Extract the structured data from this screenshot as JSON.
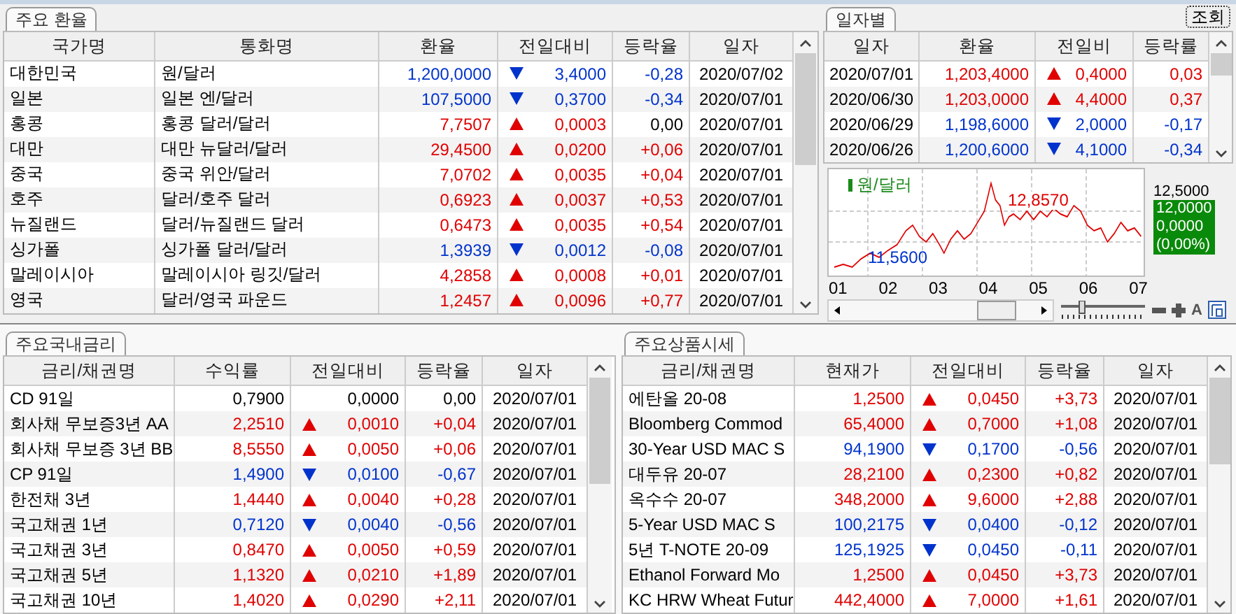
{
  "fx_panel": {
    "tab": "주요 환율",
    "columns": [
      "국가명",
      "통화명",
      "환율",
      "전일대비",
      "등락율",
      "일자"
    ],
    "rows": [
      {
        "cells": [
          "대한민국",
          "원/달러",
          "1,200,0000",
          "3,4000",
          "-0,28",
          "2020/07/02"
        ],
        "kind": "down",
        "color": "#0033cc"
      },
      {
        "cells": [
          "일본",
          "일본 엔/달러",
          "107,5000",
          "0,3700",
          "-0,34",
          "2020/07/01"
        ],
        "kind": "down",
        "color": "#0033cc"
      },
      {
        "cells": [
          "홍콩",
          "홍콩 달러/달러",
          "7,7507",
          "0,0003",
          "0,00",
          "2020/07/01"
        ],
        "kind": "up",
        "color": "#000000"
      },
      {
        "cells": [
          "대만",
          "대만 뉴달러/달러",
          "29,4500",
          "0,0200",
          "+0,06",
          "2020/07/01"
        ],
        "kind": "up",
        "color": "#e00000"
      },
      {
        "cells": [
          "중국",
          "중국 위안/달러",
          "7,0702",
          "0,0035",
          "+0,04",
          "2020/07/01"
        ],
        "kind": "up",
        "color": "#e00000"
      },
      {
        "cells": [
          "호주",
          "달러/호주 달러",
          "0,6923",
          "0,0037",
          "+0,53",
          "2020/07/01"
        ],
        "kind": "up",
        "color": "#e00000"
      },
      {
        "cells": [
          "뉴질랜드",
          "달러/뉴질랜드 달러",
          "0,6473",
          "0,0035",
          "+0,54",
          "2020/07/01"
        ],
        "kind": "up",
        "color": "#e00000"
      },
      {
        "cells": [
          "싱가폴",
          "싱가폴 달러/달러",
          "1,3939",
          "0,0012",
          "-0,08",
          "2020/07/01"
        ],
        "kind": "down",
        "color": "#0033cc"
      },
      {
        "cells": [
          "말레이시아",
          "말레이시아 링깃/달러",
          "4,2858",
          "0,0008",
          "+0,01",
          "2020/07/01"
        ],
        "kind": "up",
        "color": "#e00000"
      },
      {
        "cells": [
          "영국",
          "달러/영국 파운드",
          "1,2457",
          "0,0096",
          "+0,77",
          "2020/07/01"
        ],
        "kind": "up",
        "color": "#e00000"
      }
    ]
  },
  "daily_panel": {
    "tab": "일자별",
    "query_button": "조회",
    "columns": [
      "일자",
      "환율",
      "전일비",
      "등락률"
    ],
    "rows": [
      {
        "cells": [
          "2020/07/01",
          "1,203,4000",
          "0,4000",
          "0,03"
        ],
        "kind": "up",
        "color": "#e00000"
      },
      {
        "cells": [
          "2020/06/30",
          "1,203,0000",
          "4,4000",
          "0,37"
        ],
        "kind": "up",
        "color": "#e00000"
      },
      {
        "cells": [
          "2020/06/29",
          "1,198,6000",
          "2,0000",
          "-0,17"
        ],
        "kind": "down",
        "color": "#0033cc"
      },
      {
        "cells": [
          "2020/06/26",
          "1,200,6000",
          "4,1000",
          "-0,34"
        ],
        "kind": "down",
        "color": "#0033cc"
      }
    ],
    "chart": {
      "zoom_slider": {
        "level": 0.25
      },
      "legend": "원/달러",
      "high_label": "12,8570",
      "low_label": "11,5600",
      "axis_label": "12,5000",
      "current_value": "12,0000",
      "current_change": "0,0000",
      "current_pct": "(0,00%)",
      "x_labels": [
        "01",
        "02",
        "03",
        "04",
        "05",
        "06",
        "07"
      ],
      "font_button": "A"
    }
  },
  "rates_panel": {
    "tab": "주요국내금리",
    "columns": [
      "금리/채권명",
      "수익률",
      "전일대비",
      "등락율",
      "일자"
    ],
    "rows": [
      {
        "cells": [
          "CD 91일",
          "0,7900",
          "0,0000",
          "0,00",
          "2020/07/01"
        ],
        "kind": "flat",
        "color": "#000000"
      },
      {
        "cells": [
          "회사채 무보증3년 AA",
          "2,2510",
          "0,0010",
          "+0,04",
          "2020/07/01"
        ],
        "kind": "up",
        "color": "#e00000"
      },
      {
        "cells": [
          "회사채 무보증 3년 BB",
          "8,5550",
          "0,0050",
          "+0,06",
          "2020/07/01"
        ],
        "kind": "up",
        "color": "#e00000"
      },
      {
        "cells": [
          "CP 91일",
          "1,4900",
          "0,0100",
          "-0,67",
          "2020/07/01"
        ],
        "kind": "down",
        "color": "#0033cc"
      },
      {
        "cells": [
          "한전채 3년",
          "1,4440",
          "0,0040",
          "+0,28",
          "2020/07/01"
        ],
        "kind": "up",
        "color": "#e00000"
      },
      {
        "cells": [
          "국고채권 1년",
          "0,7120",
          "0,0040",
          "-0,56",
          "2020/07/01"
        ],
        "kind": "down",
        "color": "#0033cc"
      },
      {
        "cells": [
          "국고채권 3년",
          "0,8470",
          "0,0050",
          "+0,59",
          "2020/07/01"
        ],
        "kind": "up",
        "color": "#e00000"
      },
      {
        "cells": [
          "국고채권 5년",
          "1,1320",
          "0,0210",
          "+1,89",
          "2020/07/01"
        ],
        "kind": "up",
        "color": "#e00000"
      },
      {
        "cells": [
          "국고채권 10년",
          "1,4020",
          "0,0290",
          "+2,11",
          "2020/07/01"
        ],
        "kind": "up",
        "color": "#e00000"
      }
    ]
  },
  "commodities_panel": {
    "tab": "주요상품시세",
    "columns": [
      "금리/채권명",
      "현재가",
      "전일대비",
      "등락율",
      "일자"
    ],
    "rows": [
      {
        "cells": [
          "에탄올 20-08",
          "1,2500",
          "0,0450",
          "+3,73",
          "2020/07/01"
        ],
        "kind": "up",
        "color": "#e00000"
      },
      {
        "cells": [
          "Bloomberg Commod",
          "65,4000",
          "0,7000",
          "+1,08",
          "2020/07/01"
        ],
        "kind": "up",
        "color": "#e00000"
      },
      {
        "cells": [
          "30-Year USD MAC S",
          "94,1900",
          "0,1700",
          "-0,56",
          "2020/07/01"
        ],
        "kind": "down",
        "color": "#0033cc"
      },
      {
        "cells": [
          "대두유 20-07",
          "28,2100",
          "0,2300",
          "+0,82",
          "2020/07/01"
        ],
        "kind": "up",
        "color": "#e00000"
      },
      {
        "cells": [
          "옥수수 20-07",
          "348,2000",
          "9,6000",
          "+2,88",
          "2020/07/01"
        ],
        "kind": "up",
        "color": "#e00000"
      },
      {
        "cells": [
          "5-Year USD MAC S",
          "100,2175",
          "0,0400",
          "-0,12",
          "2020/07/01"
        ],
        "kind": "down",
        "color": "#0033cc"
      },
      {
        "cells": [
          "5년 T-NOTE 20-09",
          "125,1925",
          "0,0450",
          "-0,11",
          "2020/07/01"
        ],
        "kind": "down",
        "color": "#0033cc"
      },
      {
        "cells": [
          "Ethanol Forward Mo",
          "1,2500",
          "0,0450",
          "+3,73",
          "2020/07/01"
        ],
        "kind": "up",
        "color": "#e00000"
      },
      {
        "cells": [
          "KC HRW Wheat Futur",
          "442,4000",
          "7,0000",
          "+1,61",
          "2020/07/01"
        ],
        "kind": "up",
        "color": "#e00000"
      }
    ]
  }
}
